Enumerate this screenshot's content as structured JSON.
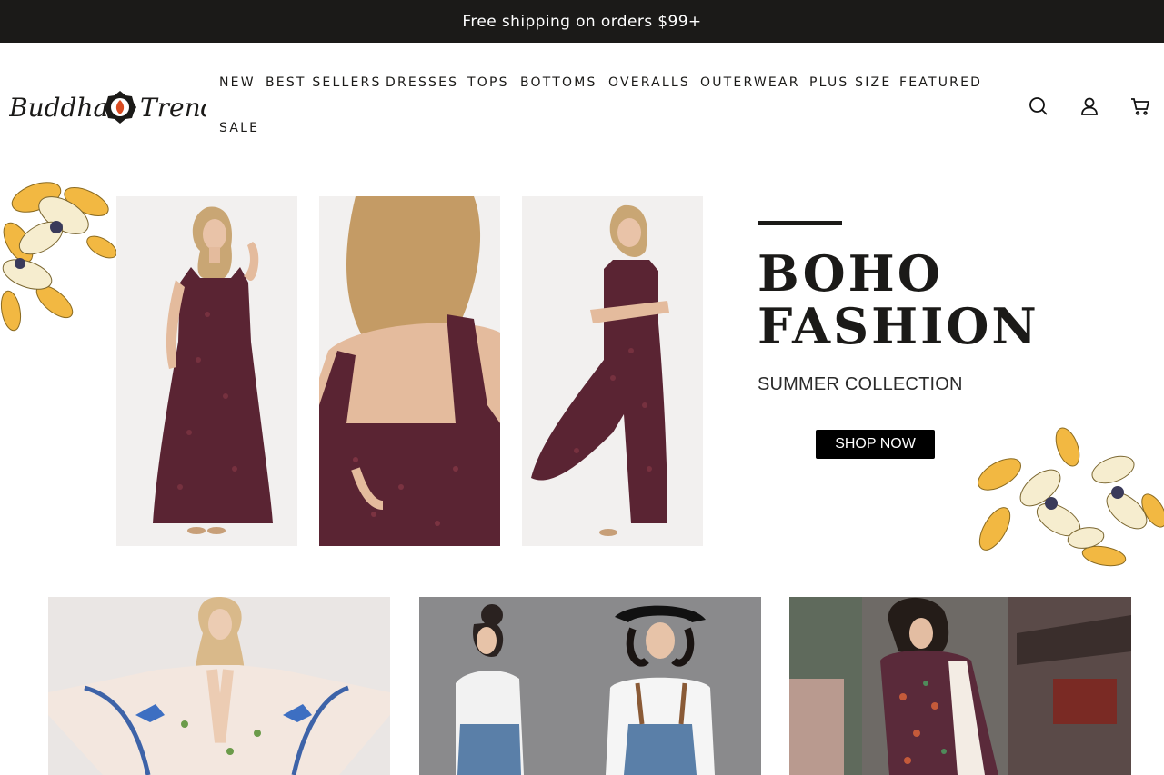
{
  "announcement": {
    "text": "Free shipping on orders $99+"
  },
  "header": {
    "logo": {
      "part1": "Buddha",
      "part2": "Trends"
    },
    "nav": [
      "NEW",
      "BEST SELLERS",
      "DRESSES",
      "TOPS",
      "BOTTOMS",
      "OVERALLS",
      "OUTERWEAR",
      "PLUS SIZE",
      "FEATURED",
      "SALE"
    ],
    "icons": [
      "search-icon",
      "account-icon",
      "cart-icon"
    ]
  },
  "hero": {
    "title_line1": "BOHO",
    "title_line2": "FASHION",
    "subtitle": "SUMMER COLLECTION",
    "button_label": "SHOP NOW"
  },
  "colors": {
    "announce_bg": "#1b1a18",
    "jumpsuit": "#5a2433",
    "flower_yellow": "#f2b842",
    "button_bg": "#000000"
  }
}
